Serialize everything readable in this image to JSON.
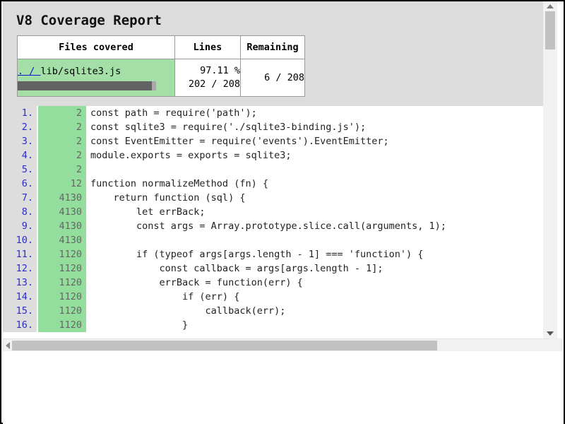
{
  "report": {
    "title": "V8 Coverage Report",
    "table": {
      "headers": [
        "Files covered",
        "Lines",
        "Remaining"
      ],
      "row": {
        "link_text": ". / ",
        "file_name": "lib/sqlite3.js",
        "progress_percent": 97.11,
        "lines_percent": "97.11 %",
        "lines_ratio": "202 / 208",
        "remaining_ratio": "6 / 208"
      }
    }
  },
  "code": {
    "lines": [
      {
        "number": "1.",
        "hits": "2",
        "text": "const path = require('path');"
      },
      {
        "number": "2.",
        "hits": "2",
        "text": "const sqlite3 = require('./sqlite3-binding.js');"
      },
      {
        "number": "3.",
        "hits": "2",
        "text": "const EventEmitter = require('events').EventEmitter;"
      },
      {
        "number": "4.",
        "hits": "2",
        "text": "module.exports = exports = sqlite3;"
      },
      {
        "number": "5.",
        "hits": "2",
        "text": ""
      },
      {
        "number": "6.",
        "hits": "12",
        "text": "function normalizeMethod (fn) {"
      },
      {
        "number": "7.",
        "hits": "4130",
        "text": "    return function (sql) {"
      },
      {
        "number": "8.",
        "hits": "4130",
        "text": "        let errBack;"
      },
      {
        "number": "9.",
        "hits": "4130",
        "text": "        const args = Array.prototype.slice.call(arguments, 1);"
      },
      {
        "number": "10.",
        "hits": "4130",
        "text": ""
      },
      {
        "number": "11.",
        "hits": "1120",
        "text": "        if (typeof args[args.length - 1] === 'function') {"
      },
      {
        "number": "12.",
        "hits": "1120",
        "text": "            const callback = args[args.length - 1];"
      },
      {
        "number": "13.",
        "hits": "1120",
        "text": "            errBack = function(err) {"
      },
      {
        "number": "14.",
        "hits": "1120",
        "text": "                if (err) {"
      },
      {
        "number": "15.",
        "hits": "1120",
        "text": "                    callback(err);"
      },
      {
        "number": "16.",
        "hits": "1120",
        "text": "                }"
      }
    ]
  },
  "colors": {
    "covered_green": "#93dd9d",
    "file_row_green": "#a3dfa6",
    "line_number_blue": "#2b2bcc",
    "link_blue": "#1414cc",
    "header_gray": "#dcdcdc",
    "gutter_gray": "#dddddd",
    "progress_fill": "#636363"
  }
}
